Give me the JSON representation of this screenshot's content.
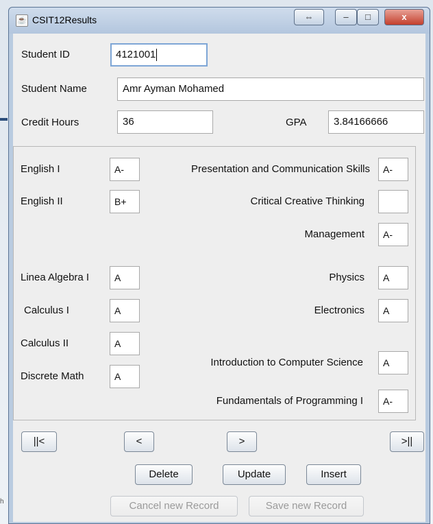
{
  "window": {
    "title": "CSIT12Results"
  },
  "titlebar_buttons": {
    "resize_glyph": "⇔",
    "minimize_glyph": "–",
    "maximize_glyph": "□",
    "close_glyph": "x",
    "close_color": "#c4402d"
  },
  "student": {
    "id_label": "Student ID",
    "id_value": "4121001",
    "name_label": "Student Name",
    "name_value": "Amr Ayman Mohamed",
    "credit_label": "Credit Hours",
    "credit_value": "36",
    "gpa_label": "GPA",
    "gpa_value": "3.84166666"
  },
  "courses_left": [
    {
      "label": "English I",
      "grade": "A-"
    },
    {
      "label": "English II",
      "grade": "B+"
    },
    {
      "label": "Linea Algebra I",
      "grade": "A"
    },
    {
      "label": "Calculus I",
      "grade": "A"
    },
    {
      "label": "Calculus II",
      "grade": "A"
    },
    {
      "label": "Discrete Math",
      "grade": "A"
    }
  ],
  "courses_right": [
    {
      "label": "Presentation and Communication Skills",
      "grade": "A-"
    },
    {
      "label": "Critical Creative Thinking",
      "grade": ""
    },
    {
      "label": "Management",
      "grade": "A-"
    },
    {
      "label": "Physics",
      "grade": "A"
    },
    {
      "label": "Electronics",
      "grade": "A"
    },
    {
      "label": "Introduction to Computer Science",
      "grade": "A"
    },
    {
      "label": "Fundamentals of Programming I",
      "grade": "A-"
    }
  ],
  "navigation": {
    "first": "||<",
    "prev": "<",
    "next": ">",
    "last": ">||"
  },
  "actions": {
    "delete": "Delete",
    "update": "Update",
    "insert": "Insert"
  },
  "record_actions": {
    "cancel": "Cancel new Record",
    "save": "Save new Record"
  },
  "edge_text": "h"
}
